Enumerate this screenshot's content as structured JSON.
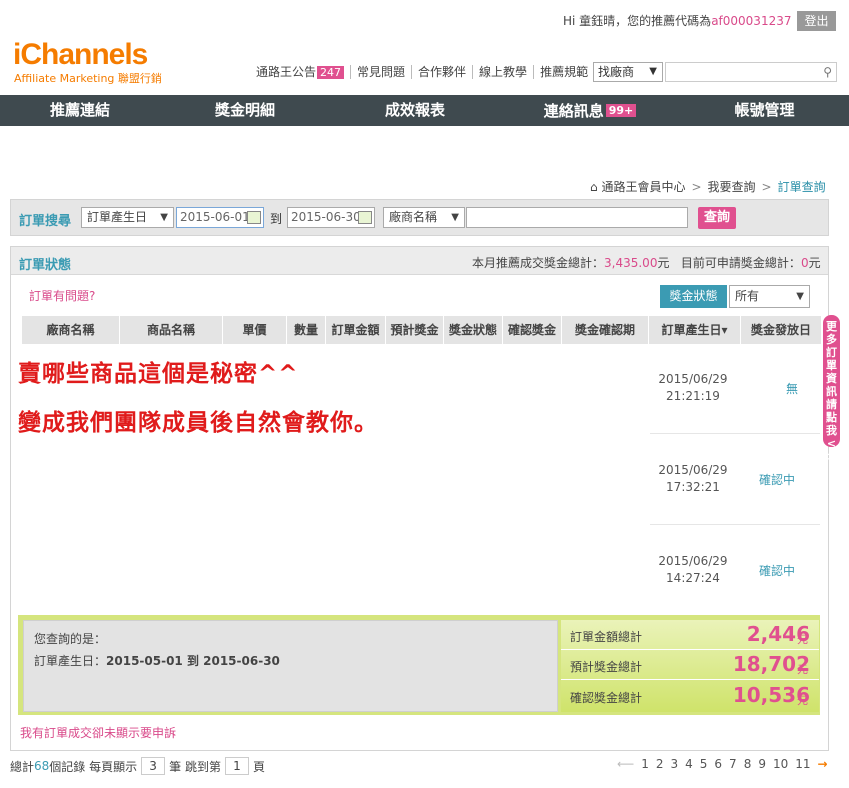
{
  "header": {
    "greeting": "Hi 童鈺晴，您的推薦代碼為",
    "code": "af000031237",
    "logout": "登出",
    "logo": "iChannels",
    "logo_sub": "Affiliate Marketing 聯盟行銷",
    "links": [
      {
        "label": "通路王公告",
        "badge": "247"
      },
      {
        "label": "常見問題"
      },
      {
        "label": "合作夥伴"
      },
      {
        "label": "線上教學"
      },
      {
        "label": "推薦規範"
      }
    ],
    "vendor_select": "找廠商",
    "search_placeholder": ""
  },
  "nav": [
    {
      "label": "推薦連結"
    },
    {
      "label": "獎金明細"
    },
    {
      "label": "成效報表"
    },
    {
      "label": "連絡訊息",
      "badge": "99+"
    },
    {
      "label": "帳號管理"
    }
  ],
  "breadcrumb": [
    "通路王會員中心",
    "我要查詢",
    "訂單查詢"
  ],
  "search": {
    "label": "訂單搜尋",
    "date_type": "訂單產生日",
    "date_from": "2015-06-01",
    "to": "到",
    "date_to": "2015-06-30",
    "vendor_field": "廠商名稱",
    "keyword": "",
    "button": "查詢"
  },
  "status": {
    "label": "訂單狀態",
    "month_total_label": "本月推薦成交獎金總計：",
    "month_total": "3,435.00",
    "unit": "元",
    "applicable_label": "目前可申請獎金總計：",
    "applicable": "0",
    "problem_link": "訂單有問題?",
    "filter_label": "獎金狀態",
    "filter_value": "所有"
  },
  "table": {
    "headers": [
      "廠商名稱",
      "商品名稱",
      "單價",
      "數量",
      "訂單金額",
      "預計獎金",
      "獎金狀態",
      "確認獎金",
      "獎金確認期",
      "訂單產生日▾",
      "獎金發放日"
    ],
    "rows": [
      {
        "date": "2015/06/29",
        "time": "21:21:19",
        "status": "無"
      },
      {
        "date": "2015/06/29",
        "time": "17:32:21",
        "status": "確認中"
      },
      {
        "date": "2015/06/29",
        "time": "14:27:24",
        "status": "確認中"
      }
    ]
  },
  "overlay": {
    "line1": "賣哪些商品這個是秘密^^",
    "line2": "變成我們團隊成員後自然會教你。"
  },
  "side_tab": "更多訂單資訊請點我<>",
  "summary": {
    "query_label": "您查詢的是：",
    "query_field": "訂單產生日：",
    "query_value": "2015-05-01 到 2015-06-30",
    "items": [
      {
        "label": "訂單金額總計",
        "value": "2,446",
        "unit": "元"
      },
      {
        "label": "預計獎金總計",
        "value": "18,702",
        "unit": "元"
      },
      {
        "label": "確認獎金總計",
        "value": "10,536",
        "unit": "元"
      }
    ]
  },
  "complain_link": "我有訂單成交卻未顯示要申訴",
  "footer": {
    "total_prefix": "總計",
    "total": "68",
    "total_suffix": "個記錄 每頁顯示",
    "per_page": "3",
    "per_page_suffix": "筆 跳到第",
    "page": "1",
    "page_suffix": "頁",
    "pages": [
      "1",
      "2",
      "3",
      "4",
      "5",
      "6",
      "7",
      "8",
      "9",
      "10",
      "11"
    ]
  },
  "colors": {
    "accent": "#3b9bb3",
    "brand": "#f57c00",
    "pink": "#e0508f",
    "nav": "#3f4a4f"
  }
}
